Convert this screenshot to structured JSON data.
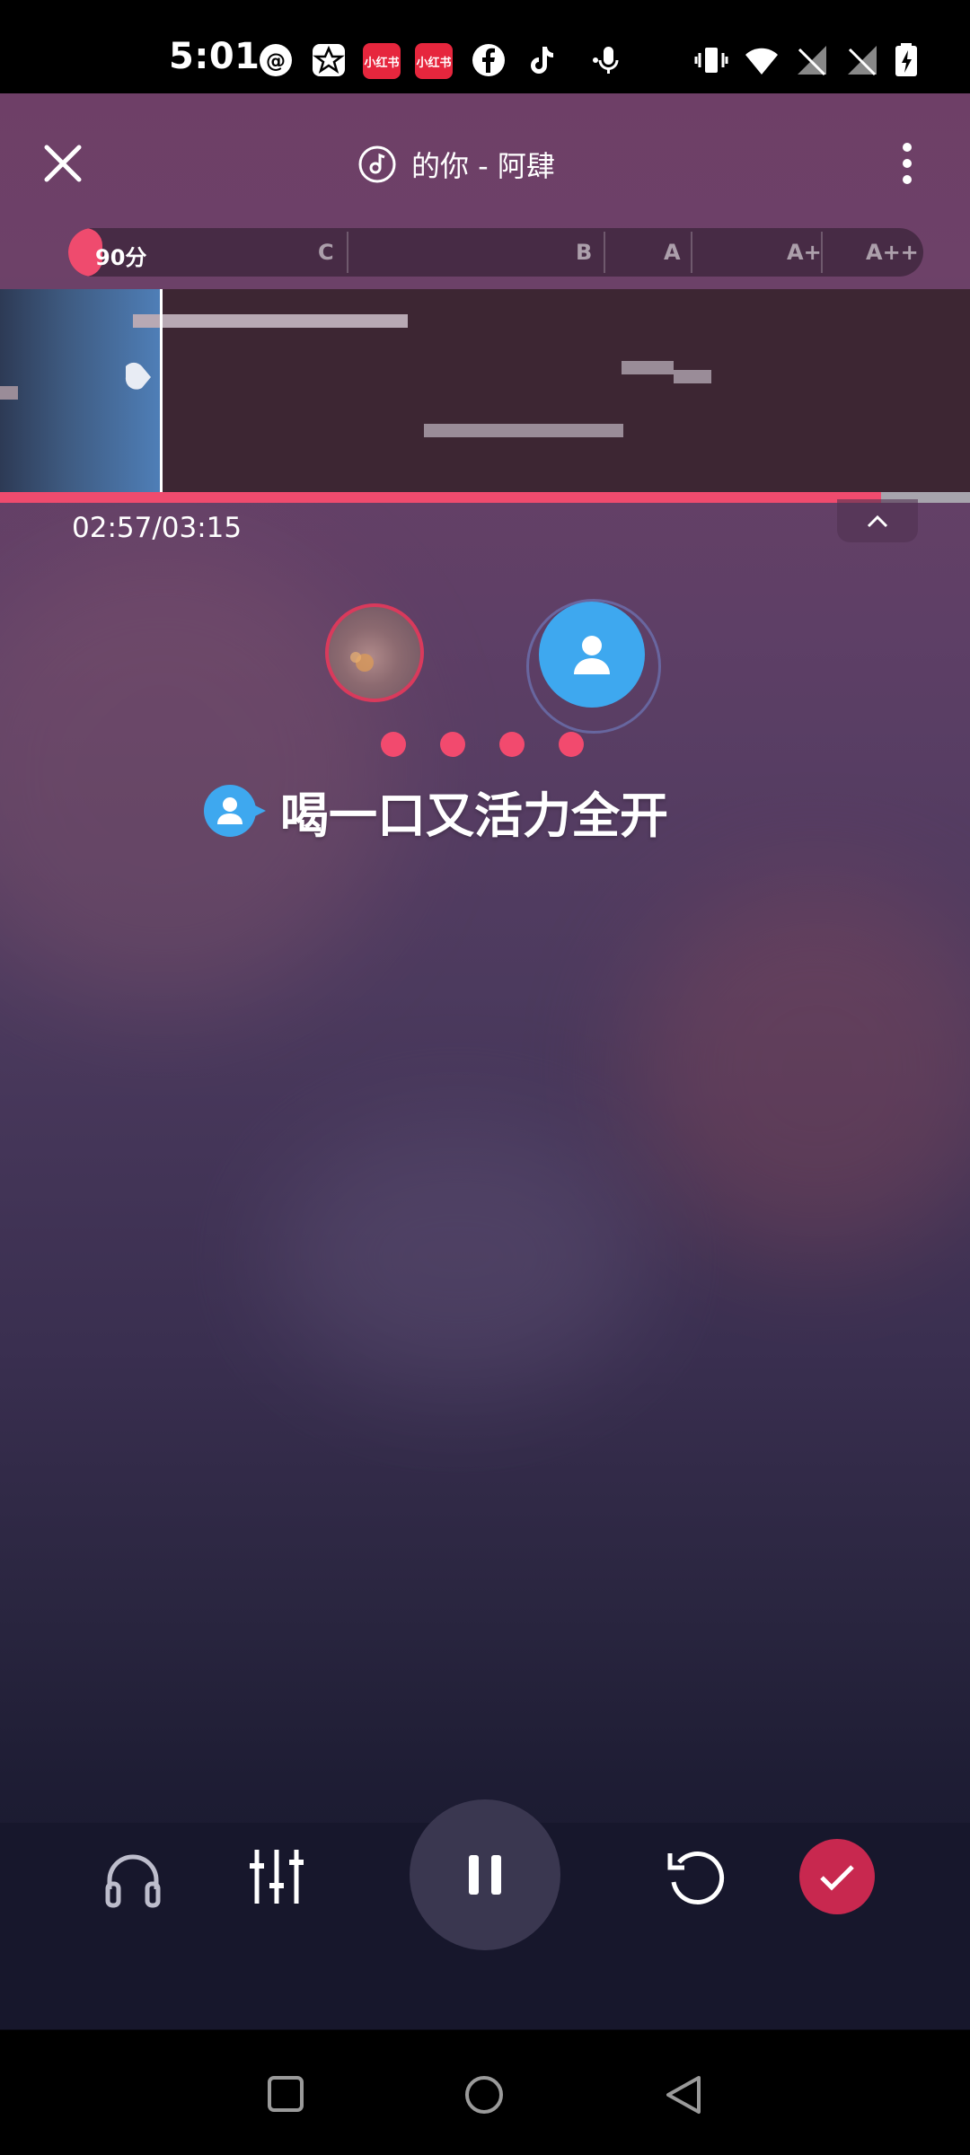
{
  "status_bar": {
    "time": "5:01",
    "badge_1": "小红书",
    "badge_2": "小红书",
    "icons": [
      "threads-icon",
      "star-icon",
      "xiaohongshu-icon",
      "xiaohongshu-icon",
      "facebook-icon",
      "tiktok-icon",
      "microphone-icon",
      "vibrate-icon",
      "wifi-icon",
      "signal-icon",
      "signal-icon",
      "battery-charging-icon"
    ]
  },
  "header": {
    "song_title": "的你 - 阿肆",
    "close_icon": "close-icon",
    "more_icon": "more-vertical-icon"
  },
  "score": {
    "current": "90分",
    "grades": [
      "C",
      "B",
      "A",
      "A+",
      "A++"
    ],
    "fill_fraction": 0.04
  },
  "playback": {
    "time": "02:57/03:15",
    "progress_fraction": 0.908
  },
  "lyric": {
    "line": "喝一口又活力全开"
  },
  "controls": {
    "icons": [
      "headphones-icon",
      "equalizer-icon",
      "pause-icon",
      "restart-icon",
      "check-icon"
    ]
  },
  "colors": {
    "accent": "#ef4b6e",
    "partner": "#3ea8ef"
  }
}
